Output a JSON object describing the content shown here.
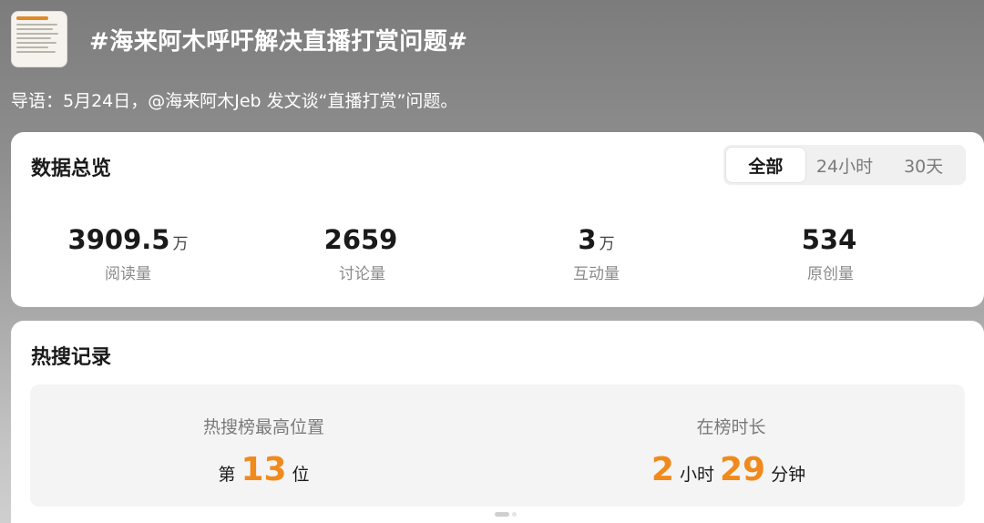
{
  "header": {
    "title": "#海来阿木呼吁解决直播打赏问题#",
    "thumbnail": "article-thumbnail"
  },
  "intro": "导语：5月24日，@海来阿木Jeb 发文谈“直播打赏”问题。",
  "overview": {
    "title": "数据总览",
    "tabs": [
      {
        "label": "全部",
        "active": true
      },
      {
        "label": "24小时",
        "active": false
      },
      {
        "label": "30天",
        "active": false
      }
    ],
    "stats": [
      {
        "value": "3909.5",
        "unit": "万",
        "label": "阅读量"
      },
      {
        "value": "2659",
        "unit": "",
        "label": "讨论量"
      },
      {
        "value": "3",
        "unit": "万",
        "label": "互动量"
      },
      {
        "value": "534",
        "unit": "",
        "label": "原创量"
      }
    ]
  },
  "hot": {
    "title": "热搜记录",
    "peak": {
      "label": "热搜榜最高位置",
      "prefix": "第",
      "number": "13",
      "suffix": "位"
    },
    "duration": {
      "label": "在榜时长",
      "hours": "2",
      "hours_unit": "小时",
      "minutes": "29",
      "minutes_unit": "分钟"
    }
  },
  "colors": {
    "accent": "#f08a1c",
    "card_bg": "#ffffff",
    "box_bg": "#f4f4f4"
  }
}
